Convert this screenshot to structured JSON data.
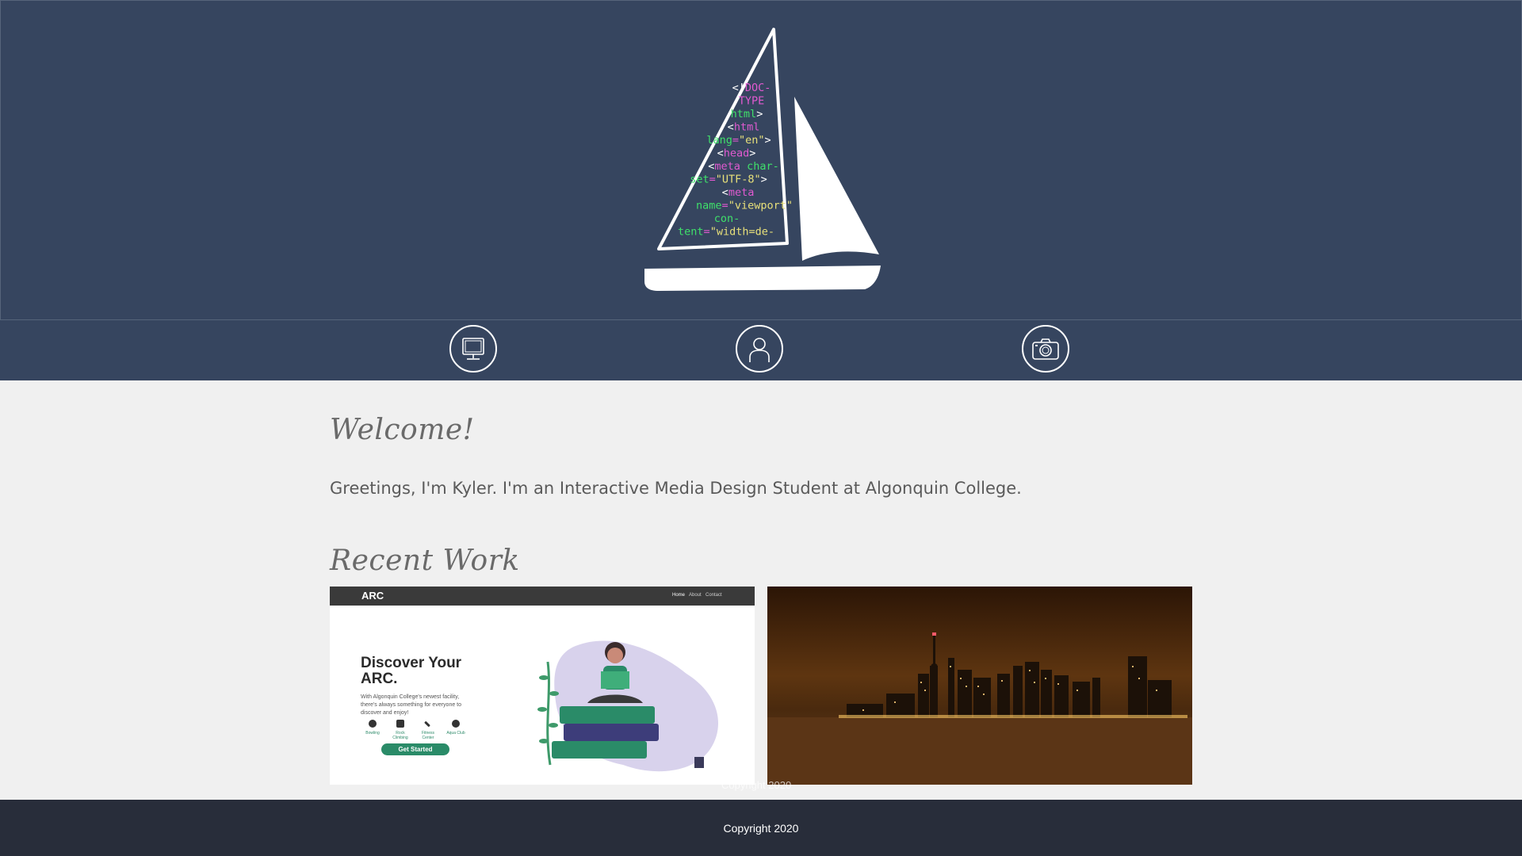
{
  "hero": {
    "code_lines": [
      [
        {
          "t": "<!",
          "c": "#ffffff"
        },
        {
          "t": "DOC-",
          "c": "#e05ad0"
        }
      ],
      [
        {
          "t": "TYPE",
          "c": "#e05ad0"
        }
      ],
      [
        {
          "t": "html",
          "c": "#3fe06a"
        },
        {
          "t": ">",
          "c": "#ffffff"
        }
      ],
      [
        {
          "t": "<",
          "c": "#ffffff"
        },
        {
          "t": "html",
          "c": "#e05ad0"
        }
      ],
      [
        {
          "t": "lang",
          "c": "#3fe06a"
        },
        {
          "t": "=",
          "c": "#e05ad0"
        },
        {
          "t": "\"en\"",
          "c": "#e8e07a"
        },
        {
          "t": ">",
          "c": "#ffffff"
        }
      ],
      [
        {
          "t": "<",
          "c": "#ffffff"
        },
        {
          "t": "head",
          "c": "#e05ad0"
        },
        {
          "t": ">",
          "c": "#ffffff"
        }
      ],
      [
        {
          "t": "<",
          "c": "#ffffff"
        },
        {
          "t": "meta ",
          "c": "#e05ad0"
        },
        {
          "t": "char-",
          "c": "#3fe06a"
        }
      ],
      [
        {
          "t": "set",
          "c": "#3fe06a"
        },
        {
          "t": "=",
          "c": "#e05ad0"
        },
        {
          "t": "\"UTF-8\"",
          "c": "#e8e07a"
        },
        {
          "t": ">",
          "c": "#ffffff"
        }
      ],
      [
        {
          "t": "<",
          "c": "#ffffff"
        },
        {
          "t": "meta",
          "c": "#e05ad0"
        }
      ],
      [
        {
          "t": "name",
          "c": "#3fe06a"
        },
        {
          "t": "=",
          "c": "#e05ad0"
        },
        {
          "t": "\"viewport\"",
          "c": "#e8e07a"
        }
      ],
      [
        {
          "t": "con-",
          "c": "#3fe06a"
        }
      ],
      [
        {
          "t": "tent",
          "c": "#3fe06a"
        },
        {
          "t": "=",
          "c": "#e05ad0"
        },
        {
          "t": "\"width=de-",
          "c": "#e8e07a"
        }
      ]
    ]
  },
  "nav": {
    "items": [
      {
        "name": "nav-computer-button",
        "icon": "computer-icon"
      },
      {
        "name": "nav-about-button",
        "icon": "person-icon"
      },
      {
        "name": "nav-photography-button",
        "icon": "camera-icon"
      }
    ]
  },
  "main": {
    "welcome_heading": "Welcome!",
    "intro_text": "Greetings, I'm Kyler. I'm an Interactive Media Design Student at Algonquin College.",
    "recent_heading": "Recent Work"
  },
  "work": {
    "arc": {
      "logo": "ARC",
      "nav": [
        "Home",
        "About",
        "Contact"
      ],
      "title": "Discover Your ARC.",
      "subtitle": "With Algonquin College's newest facility, there's always something for everyone to discover and enjoy!",
      "features": [
        "Bowling",
        "Rock Climbing",
        "Fitness Center",
        "Aqua Club"
      ],
      "cta": "Get Started"
    },
    "skyline": {
      "alt": "city-skyline-night-photo"
    }
  },
  "ghost_text": "Copyright 2020",
  "footer": {
    "copyright": "Copyright 2020"
  },
  "colors": {
    "header_bg": "#36455f",
    "footer_bg": "#282d3a",
    "page_bg": "#f0f0f0",
    "accent_green": "#2a8b68"
  }
}
